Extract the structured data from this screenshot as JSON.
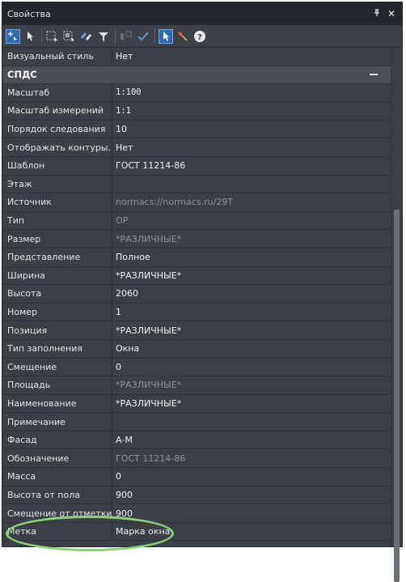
{
  "window": {
    "title": "Свойства",
    "pin_glyph": "ᴩ",
    "close_glyph": "✕"
  },
  "toolbar": {
    "icons": [
      "add-selection-icon",
      "pointer-icon",
      "select-region-icon",
      "select-window-icon",
      "select-objects-icon",
      "filter-icon",
      "filter-disabled-icon",
      "filter-check-icon",
      "select-mode-icon",
      "quick-select-icon",
      "help-icon"
    ],
    "help_glyph": "?"
  },
  "rows_top": [
    {
      "name": "Визуальный стиль",
      "value": "Нет"
    }
  ],
  "section": {
    "label": "СПДС"
  },
  "rows": [
    {
      "name": "Масштаб",
      "value": "1:100",
      "style": "mono"
    },
    {
      "name": "Масштаб измерений",
      "value": "1:1",
      "style": "mono"
    },
    {
      "name": "Порядок следования",
      "value": "10"
    },
    {
      "name": "Отображать контуры...",
      "value": "Нет"
    },
    {
      "name": "Шаблон",
      "value": "ГОСТ 11214-86"
    },
    {
      "name": "Этаж",
      "value": ""
    },
    {
      "name": "Источник",
      "value": "normacs://normacs.ru/29T",
      "style": "dim"
    },
    {
      "name": "Тип",
      "value": "ОР",
      "style": "dim"
    },
    {
      "name": "Размер",
      "value": "*РАЗЛИЧНЫЕ*",
      "style": "dim"
    },
    {
      "name": "Представление",
      "value": "Полное"
    },
    {
      "name": "Ширина",
      "value": "*РАЗЛИЧНЫЕ*"
    },
    {
      "name": "Высота",
      "value": "2060"
    },
    {
      "name": "Номер",
      "value": "1"
    },
    {
      "name": "Позиция",
      "value": "*РАЗЛИЧНЫЕ*"
    },
    {
      "name": "Тип заполнения",
      "value": "Окна"
    },
    {
      "name": "Смещение",
      "value": "0"
    },
    {
      "name": "Площадь",
      "value": "*РАЗЛИЧНЫЕ*",
      "style": "dim"
    },
    {
      "name": "Наименование",
      "value": "*РАЗЛИЧНЫЕ*"
    },
    {
      "name": "Примечание",
      "value": ""
    },
    {
      "name": "Фасад",
      "value": "А-М"
    },
    {
      "name": "Обозначение",
      "value": "ГОСТ 11214-86",
      "style": "dim"
    },
    {
      "name": "Масса",
      "value": "0"
    },
    {
      "name": "Высота от пола",
      "value": "900"
    },
    {
      "name": "Смещение от отметки",
      "value": "900"
    },
    {
      "name": "Метка",
      "value": "Марка окна"
    }
  ]
}
